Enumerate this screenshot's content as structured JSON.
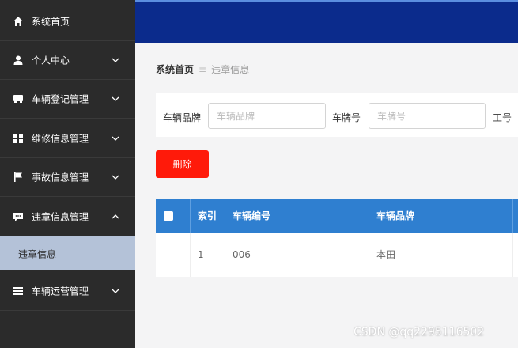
{
  "sidebar": {
    "items": [
      {
        "label": "系统首页",
        "icon": "home-icon"
      },
      {
        "label": "个人中心",
        "icon": "user-icon"
      },
      {
        "label": "车辆登记管理",
        "icon": "car-icon"
      },
      {
        "label": "维修信息管理",
        "icon": "grid-icon"
      },
      {
        "label": "事故信息管理",
        "icon": "flag-icon"
      },
      {
        "label": "违章信息管理",
        "icon": "chat-icon"
      },
      {
        "label": "车辆运营管理",
        "icon": "list-icon"
      }
    ],
    "sub_item": {
      "label": "违章信息"
    }
  },
  "breadcrumb": {
    "home": "系统首页",
    "separator": "≡",
    "current": "违章信息"
  },
  "search": {
    "brand_label": "车辆品牌",
    "brand_placeholder": "车辆品牌",
    "plate_label": "车牌号",
    "plate_placeholder": "车牌号",
    "worker_label": "工号"
  },
  "actions": {
    "delete_label": "删除"
  },
  "table": {
    "headers": [
      "索引",
      "车辆编号",
      "车辆品牌"
    ],
    "rows": [
      {
        "index": "1",
        "vehicle_no": "006",
        "brand": "本田"
      }
    ]
  },
  "watermark": "CSDN @qq2295116502",
  "colors": {
    "sidebar": "#2b2b2b",
    "topbar": "#0b2b8c",
    "table_header": "#2f7fd0",
    "delete_button": "#ff1a0a",
    "active_sub": "#b4c2d8"
  }
}
